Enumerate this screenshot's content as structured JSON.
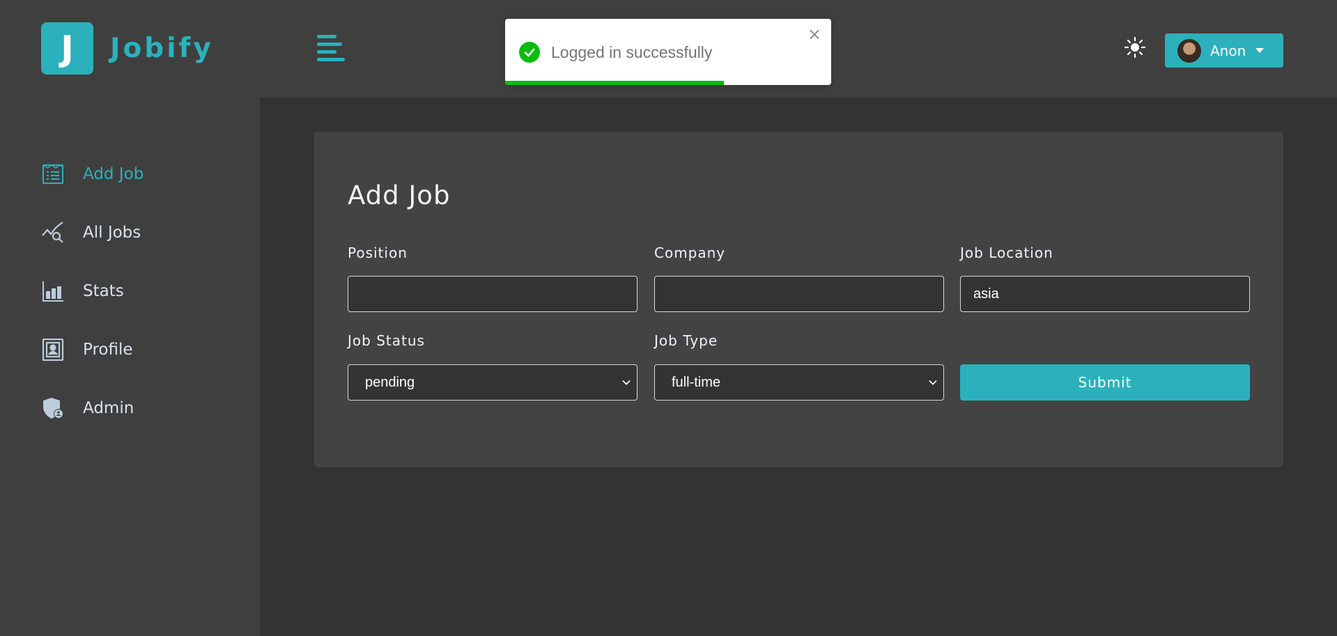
{
  "brand": {
    "logo_letter": "J",
    "name": "Jobify",
    "accent": "#2cb1bc"
  },
  "sidebar": {
    "items": [
      {
        "label": "Add Job",
        "icon": "add-job-icon",
        "active": true
      },
      {
        "label": "All Jobs",
        "icon": "all-jobs-icon",
        "active": false
      },
      {
        "label": "Stats",
        "icon": "stats-icon",
        "active": false
      },
      {
        "label": "Profile",
        "icon": "profile-icon",
        "active": false
      },
      {
        "label": "Admin",
        "icon": "admin-icon",
        "active": false
      }
    ]
  },
  "topbar": {
    "menu_icon": "hamburger-icon",
    "theme_icon": "sun-icon",
    "user": {
      "name": "Anon",
      "avatar": "avatar"
    }
  },
  "toast": {
    "message": "Logged in successfully",
    "close": "×",
    "progress": 0.67,
    "color": "#07bc0c"
  },
  "form": {
    "title": "Add Job",
    "position": {
      "label": "Position",
      "value": ""
    },
    "company": {
      "label": "Company",
      "value": ""
    },
    "location": {
      "label": "Job Location",
      "value": "asia"
    },
    "status": {
      "label": "Job Status",
      "value": "pending"
    },
    "type": {
      "label": "Job Type",
      "value": "full-time"
    },
    "submit": "Submit"
  }
}
